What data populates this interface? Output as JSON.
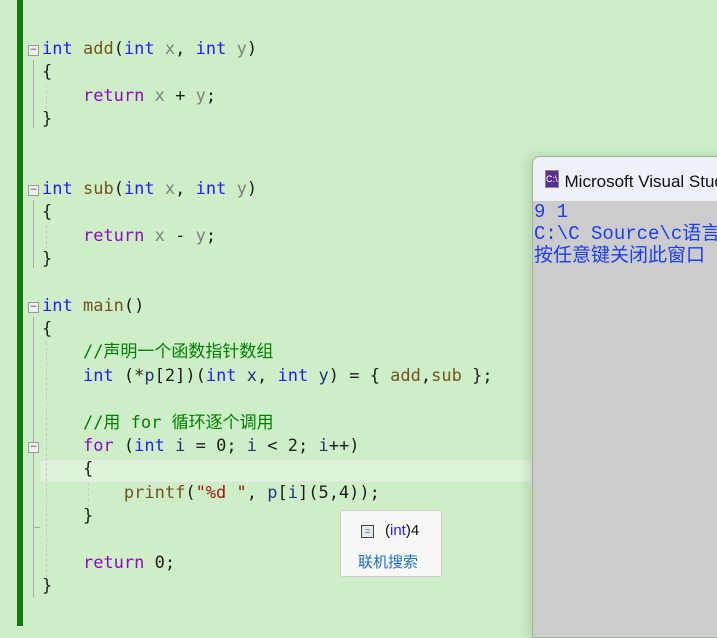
{
  "editor": {
    "lines": [
      [
        [
          "int",
          "kw"
        ],
        [
          " ",
          ""
        ],
        [
          "add",
          "fn"
        ],
        [
          "(",
          "op"
        ],
        [
          "int",
          "kw"
        ],
        [
          " ",
          ""
        ],
        [
          "x",
          "param"
        ],
        [
          ", ",
          "op"
        ],
        [
          "int",
          "kw"
        ],
        [
          " ",
          ""
        ],
        [
          "y",
          "param"
        ],
        [
          ")",
          "op"
        ]
      ],
      [
        [
          "{",
          "op"
        ]
      ],
      [
        [
          "    ",
          ""
        ],
        [
          "return",
          "ctl"
        ],
        [
          " ",
          ""
        ],
        [
          "x",
          "param"
        ],
        [
          " + ",
          "op"
        ],
        [
          "y",
          "param"
        ],
        [
          ";",
          "op"
        ]
      ],
      [
        [
          "}",
          "op"
        ]
      ],
      [],
      [],
      [
        [
          "int",
          "kw"
        ],
        [
          " ",
          ""
        ],
        [
          "sub",
          "fn"
        ],
        [
          "(",
          "op"
        ],
        [
          "int",
          "kw"
        ],
        [
          " ",
          ""
        ],
        [
          "x",
          "param"
        ],
        [
          ", ",
          "op"
        ],
        [
          "int",
          "kw"
        ],
        [
          " ",
          ""
        ],
        [
          "y",
          "param"
        ],
        [
          ")",
          "op"
        ]
      ],
      [
        [
          "{",
          "op"
        ]
      ],
      [
        [
          "    ",
          ""
        ],
        [
          "return",
          "ctl"
        ],
        [
          " ",
          ""
        ],
        [
          "x",
          "param"
        ],
        [
          " - ",
          "op"
        ],
        [
          "y",
          "param"
        ],
        [
          ";",
          "op"
        ]
      ],
      [
        [
          "}",
          "op"
        ]
      ],
      [],
      [
        [
          "int",
          "kw"
        ],
        [
          " ",
          ""
        ],
        [
          "main",
          "fn"
        ],
        [
          "()",
          "op"
        ]
      ],
      [
        [
          "{",
          "op"
        ]
      ],
      [
        [
          "    ",
          ""
        ],
        [
          "//声明一个函数指针数组",
          "cm"
        ]
      ],
      [
        [
          "    ",
          ""
        ],
        [
          "int",
          "kw"
        ],
        [
          " (*",
          "op"
        ],
        [
          "p",
          "var"
        ],
        [
          "[2])(",
          "op"
        ],
        [
          "int",
          "kw"
        ],
        [
          " ",
          ""
        ],
        [
          "x",
          "var"
        ],
        [
          ", ",
          "op"
        ],
        [
          "int",
          "kw"
        ],
        [
          " ",
          ""
        ],
        [
          "y",
          "var"
        ],
        [
          ") = { ",
          "op"
        ],
        [
          "add",
          "fn"
        ],
        [
          ",",
          "op"
        ],
        [
          "sub",
          "fn"
        ],
        [
          " };",
          "op"
        ]
      ],
      [],
      [
        [
          "    ",
          ""
        ],
        [
          "//用 for 循环逐个调用",
          "cm"
        ]
      ],
      [
        [
          "    ",
          ""
        ],
        [
          "for",
          "ctl"
        ],
        [
          " (",
          "op"
        ],
        [
          "int",
          "kw"
        ],
        [
          " ",
          ""
        ],
        [
          "i",
          "var"
        ],
        [
          " = 0; ",
          "op"
        ],
        [
          "i",
          "var"
        ],
        [
          " < 2; ",
          "op"
        ],
        [
          "i",
          "var"
        ],
        [
          "++)",
          "op"
        ]
      ],
      [
        [
          "    ",
          ""
        ],
        [
          "{",
          "op"
        ]
      ],
      [
        [
          "        ",
          ""
        ],
        [
          "printf",
          "fn"
        ],
        [
          "(",
          "op"
        ],
        [
          "\"%d \"",
          "str"
        ],
        [
          ", ",
          "op"
        ],
        [
          "p",
          "var"
        ],
        [
          "[",
          "op"
        ],
        [
          "i",
          "var"
        ],
        [
          "](5,4));",
          "op"
        ]
      ],
      [
        [
          "    ",
          ""
        ],
        [
          "}",
          "op"
        ]
      ],
      [],
      [
        [
          "    ",
          ""
        ],
        [
          "return",
          "ctl"
        ],
        [
          " 0;",
          "op"
        ]
      ],
      [
        [
          "}",
          "op"
        ]
      ]
    ]
  },
  "console": {
    "title": "Microsoft Visual Studio 调试控制台",
    "icon": "console-app-icon",
    "icon_text": "C:\\",
    "output": [
      "9 1",
      "C:\\C Source\\c语言",
      "按任意键关闭此窗口"
    ]
  },
  "tooltip": {
    "type_prefix": "(",
    "type_kw": "int",
    "type_suffix": ")4",
    "link": "联机搜索"
  },
  "colors": {
    "accent_bar": "#107c10",
    "background": "#cdeec6",
    "console_text": "#1a3ef0"
  }
}
